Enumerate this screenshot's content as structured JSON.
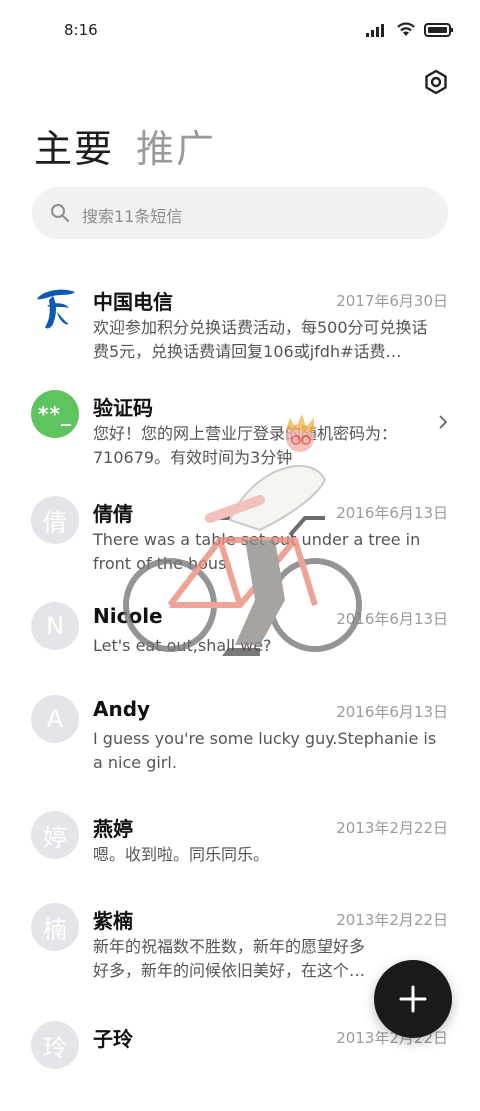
{
  "status": {
    "time": "8:16"
  },
  "tabs": {
    "primary": "主要",
    "promo": "推广"
  },
  "search": {
    "placeholder": "搜索11条短信"
  },
  "conversations": [
    {
      "name": "中国电信",
      "date": "2017年6月30日",
      "preview": "欢迎参加积分兑换话费活动，每500分可兑换话费5元，兑换话费请回复106或jfdh#话费…",
      "avatar": "telecom-logo"
    },
    {
      "name": "验证码",
      "date": "",
      "preview": "您好！您的网上营业厅登录的随机密码为：710679。有效时间为3分钟",
      "avatar_text": "**_"
    },
    {
      "name": "倩倩",
      "date": "2016年6月13日",
      "preview": "There was a table set out under a tree in front of the hous",
      "avatar_text": "倩"
    },
    {
      "name": "Nicole",
      "date": "2016年6月13日",
      "preview": "Let's eat out,shall we?",
      "avatar_text": "N"
    },
    {
      "name": "Andy",
      "date": "2016年6月13日",
      "preview": "I guess you're some lucky guy.Stephanie is a nice girl.",
      "avatar_text": "A"
    },
    {
      "name": "燕婷",
      "date": "2013年2月22日",
      "preview": "嗯。收到啦。同乐同乐。",
      "avatar_text": "婷"
    },
    {
      "name": "紫楠",
      "date": "2013年2月22日",
      "preview": "新年的祝福数不胜数，新年的愿望好多好多，新年的问候依旧美好，在这个温馨的",
      "avatar_text": "楠"
    },
    {
      "name": "子玲",
      "date": "2013年2月22日",
      "preview": "",
      "avatar_text": "玲"
    }
  ],
  "colors": {
    "accent_green": "#5dc45f",
    "telecom_blue": "#0d5ab2",
    "fab": "#1a1a1a"
  },
  "icons": {
    "settings": "hexagon-gear-icon",
    "search": "search-icon",
    "fab": "plus-icon",
    "chevron": "chevron-right-icon"
  }
}
